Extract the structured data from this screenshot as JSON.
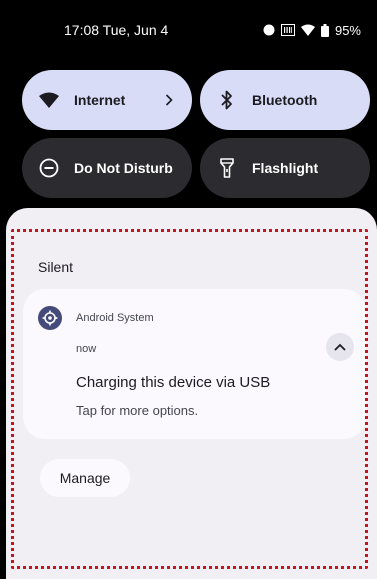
{
  "status_bar": {
    "time": "17:08 Tue, Jun 4",
    "battery": "95%",
    "icons": [
      "record-dot-icon",
      "scanner-icon",
      "wifi-icon",
      "battery-icon"
    ]
  },
  "quick_settings": {
    "tiles": [
      {
        "label": "Internet",
        "icon": "wifi-icon",
        "state": "on",
        "has_chevron": true
      },
      {
        "label": "Bluetooth",
        "icon": "bluetooth-icon",
        "state": "on"
      },
      {
        "label": "Do Not Disturb",
        "icon": "do-not-disturb-icon",
        "state": "off"
      },
      {
        "label": "Flashlight",
        "icon": "flashlight-icon",
        "state": "off"
      }
    ]
  },
  "notifications": {
    "section_title": "Silent",
    "items": [
      {
        "app_name": "Android System",
        "time": "now",
        "title": "Charging this device via USB",
        "text": "Tap for more options.",
        "icon": "settings-gear-icon"
      }
    ],
    "manage_label": "Manage"
  },
  "colors": {
    "tile_on": "#d8dcf7",
    "tile_off": "#2b2b30",
    "shade": "#f1eff4",
    "card": "#fbf9fd",
    "highlight_frame": "#c6141c"
  }
}
